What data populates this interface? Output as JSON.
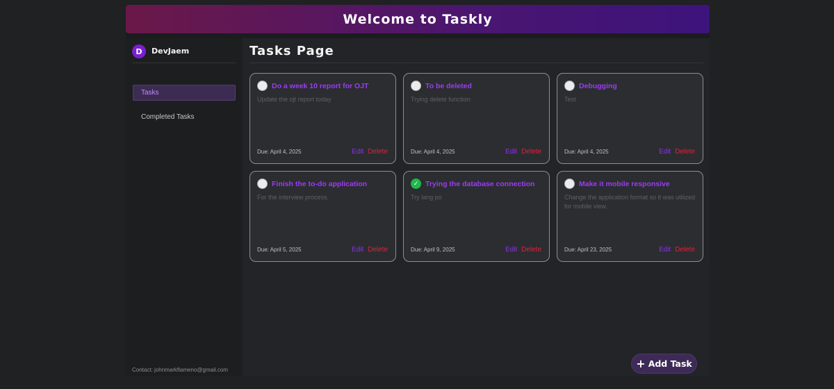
{
  "header": {
    "title": "Welcome to Taskly"
  },
  "sidebar": {
    "user": {
      "avatar_letter": "D",
      "name": "DevJaem"
    },
    "items": [
      {
        "label": "Tasks",
        "active": true
      },
      {
        "label": "Completed Tasks",
        "active": false
      }
    ],
    "contact": "Contact: johnmarkflameno@gmail.com"
  },
  "main": {
    "page_title": "Tasks Page",
    "tasks": [
      {
        "title": "Do a week 10 report for OJT",
        "description": "Update the ojt report today",
        "due": "Due: April 4, 2025",
        "completed": false
      },
      {
        "title": "To be deleted",
        "description": "Trying delete function",
        "due": "Due: April 4, 2025",
        "completed": false
      },
      {
        "title": "Debugging",
        "description": "Test",
        "due": "Due: April 4, 2025",
        "completed": false
      },
      {
        "title": "Finish the to-do application",
        "description": "For the interview process.",
        "due": "Due: April 5, 2025",
        "completed": false
      },
      {
        "title": "Trying the database connection",
        "description": "Try lang po",
        "due": "Due: April 9, 2025",
        "completed": true
      },
      {
        "title": "Make it mobile responsive",
        "description": "Change the application format so it was utilized for mobile view.",
        "due": "Due: April 23, 2025",
        "completed": false
      }
    ],
    "edit_label": "Edit",
    "delete_label": "Delete",
    "check_glyph": "✓",
    "add_task_label": "Add Task",
    "add_task_icon": "plus-icon"
  },
  "colors": {
    "accent": "#9b3bf4",
    "delete": "#e0233a",
    "completed": "#1fb84a",
    "banner_start": "#6b1848",
    "banner_end": "#3d137c"
  }
}
